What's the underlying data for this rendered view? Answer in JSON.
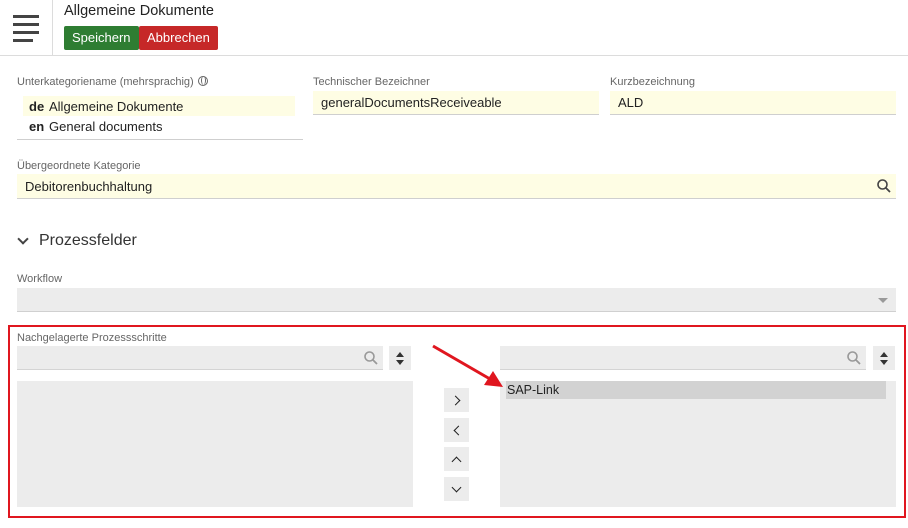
{
  "header": {
    "title": "Allgemeine Dokumente",
    "save_label": "Speichern",
    "cancel_label": "Abbrechen"
  },
  "form": {
    "subcategory_label": "Unterkategoriename (mehrsprachig)",
    "translations": [
      {
        "code": "de",
        "value": "Allgemeine Dokumente"
      },
      {
        "code": "en",
        "value": "General documents"
      }
    ],
    "technical_label": "Technischer Bezeichner",
    "technical_value": "generalDocumentsReceiveable",
    "short_label": "Kurzbezeichnung",
    "short_value": "ALD",
    "parent_label": "Übergeordnete Kategorie",
    "parent_value": "Debitorenbuchhaltung"
  },
  "process": {
    "section_title": "Prozessfelder",
    "workflow_label": "Workflow",
    "workflow_value": "",
    "steps_label": "Nachgelagerte Prozessschritte",
    "available_items": [],
    "selected_items": [
      "SAP-Link"
    ]
  },
  "colors": {
    "save": "#2e7d32",
    "cancel": "#c62828",
    "field_bg": "#fefde4",
    "highlight": "#e0161f"
  },
  "icons": {
    "menu": "hamburger-icon",
    "globe": "globe-icon",
    "search": "search-icon",
    "collapse": "chevron-down-icon",
    "sort": "sort-icon",
    "move_right": "chevron-right-icon",
    "move_left": "chevron-left-icon",
    "move_up": "chevron-up-icon",
    "move_down": "chevron-down-icon"
  }
}
